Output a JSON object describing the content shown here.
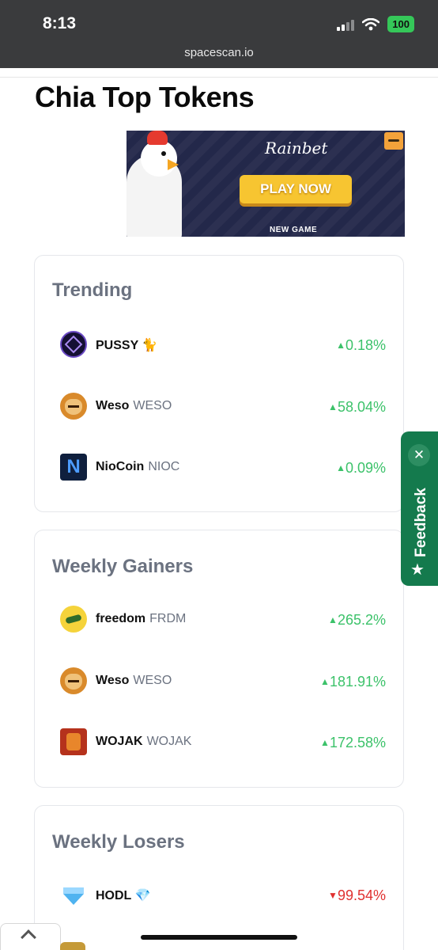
{
  "status_bar": {
    "time": "8:13",
    "battery": "100"
  },
  "browser": {
    "url": "spacescan.io"
  },
  "page": {
    "title": "Chia Top Tokens"
  },
  "ad": {
    "brand": "Rainbet",
    "cta": "PLAY NOW",
    "footer": "NEW GAME"
  },
  "trending": {
    "title": "Trending",
    "rows": [
      {
        "name": "PUSSY 🐈",
        "symbol": "",
        "change": "0.18%",
        "direction": "up",
        "icon": "pussy-token-icon"
      },
      {
        "name": "Weso",
        "symbol": "WESO",
        "change": "58.04%",
        "direction": "up",
        "icon": "weso-token-icon"
      },
      {
        "name": "NioCoin",
        "symbol": "NIOC",
        "change": "0.09%",
        "direction": "up",
        "icon": "nioc-token-icon"
      }
    ]
  },
  "weekly_gainers": {
    "title": "Weekly Gainers",
    "rows": [
      {
        "name": "freedom",
        "symbol": "FRDM",
        "change": "265.2%",
        "direction": "up",
        "icon": "frdm-token-icon"
      },
      {
        "name": "Weso",
        "symbol": "WESO",
        "change": "181.91%",
        "direction": "up",
        "icon": "weso-token-icon"
      },
      {
        "name": "WOJAK",
        "symbol": "WOJAK",
        "change": "172.58%",
        "direction": "up",
        "icon": "wojak-token-icon"
      }
    ]
  },
  "weekly_losers": {
    "title": "Weekly Losers",
    "rows": [
      {
        "name": "HODL 💎",
        "symbol": "",
        "change": "99.54%",
        "direction": "down",
        "icon": "hodl-token-icon"
      }
    ]
  },
  "arrows": {
    "up": "▲",
    "down": "▼"
  },
  "feedback": {
    "label": "Feedback",
    "close": "✕",
    "star": "★"
  },
  "colors": {
    "up": "#3cc26a",
    "down": "#e0302f",
    "feedback": "#147a4d"
  }
}
